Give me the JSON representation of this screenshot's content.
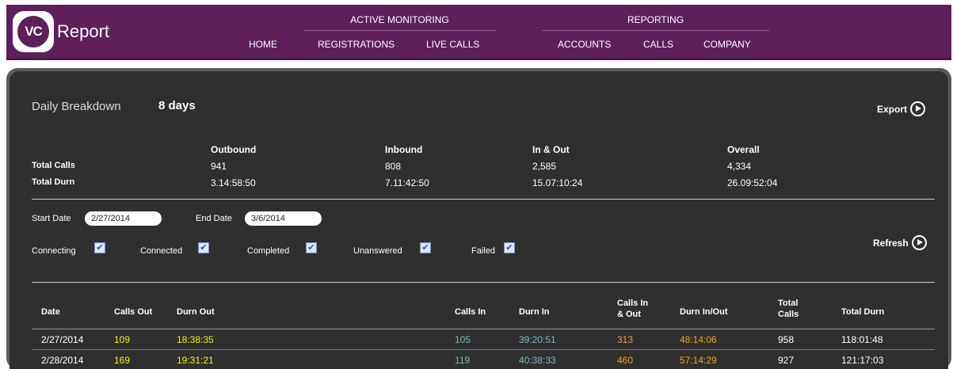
{
  "brand": {
    "logo_mark": "VC",
    "logo_text": "Report"
  },
  "nav": {
    "groups": [
      {
        "label": "ACTIVE MONITORING"
      },
      {
        "label": "REPORTING"
      }
    ],
    "items": [
      {
        "label": "HOME"
      },
      {
        "label": "REGISTRATIONS"
      },
      {
        "label": "LIVE CALLS"
      },
      {
        "label": "ACCOUNTS"
      },
      {
        "label": "CALLS"
      },
      {
        "label": "COMPANY"
      }
    ]
  },
  "report": {
    "title": "Daily Breakdown",
    "days": "8 days",
    "export_label": "Export",
    "refresh_label": "Refresh"
  },
  "summary": {
    "columns": [
      "Outbound",
      "Inbound",
      "In & Out",
      "Overall"
    ],
    "rows": [
      {
        "label": "Total Calls",
        "values": [
          "941",
          "808",
          "2,585",
          "4,334"
        ]
      },
      {
        "label": "Total Durn",
        "values": [
          "3.14:58:50",
          "7.11:42:50",
          "15.07:10:24",
          "26.09:52:04"
        ]
      }
    ]
  },
  "filters": {
    "start_label": "Start Date",
    "start_value": "2/27/2014",
    "end_label": "End Date",
    "end_value": "3/6/2014",
    "checkboxes": [
      {
        "label": "Connecting",
        "checked": true
      },
      {
        "label": "Connected",
        "checked": true
      },
      {
        "label": "Completed",
        "checked": true
      },
      {
        "label": "Unanswered",
        "checked": true
      },
      {
        "label": "Failed",
        "checked": true
      }
    ]
  },
  "table": {
    "headers": [
      "Date",
      "Calls Out",
      "Durn Out",
      "Calls In",
      "Durn In",
      "Calls In & Out",
      "Durn In/Out",
      "Total Calls",
      "Total Durn"
    ],
    "rows": [
      [
        "2/27/2014",
        "109",
        "18:38:35",
        "105",
        "39:20:51",
        "313",
        "48:14:06",
        "958",
        "118:01:48"
      ],
      [
        "2/28/2014",
        "169",
        "19:31:21",
        "119",
        "40:38:33",
        "460",
        "57:14:29",
        "927",
        "121:17:03"
      ]
    ]
  },
  "colors": {
    "header_bg": "#5e1f5c",
    "panel_bg": "#2f2f2f",
    "calls_out": "#f2f210",
    "calls_in": "#7fb6c7",
    "in_out": "#f5a21c"
  }
}
